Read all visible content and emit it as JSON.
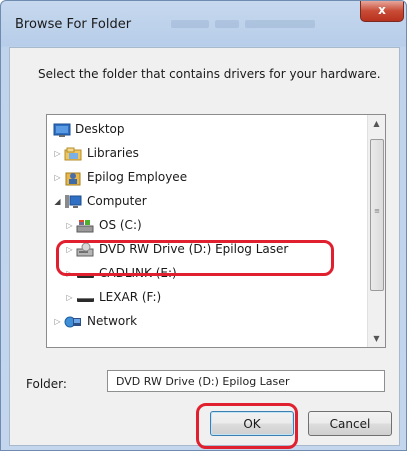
{
  "window": {
    "title": "Browse For Folder",
    "close_label": "x"
  },
  "instruction": "Select the folder that contains drivers for your hardware.",
  "tree": {
    "items": [
      {
        "label": "Desktop",
        "icon": "desktop-icon"
      },
      {
        "label": "Libraries",
        "icon": "libraries-icon"
      },
      {
        "label": "Epilog Employee",
        "icon": "user-folder-icon"
      },
      {
        "label": "Computer",
        "icon": "computer-icon"
      },
      {
        "label": "OS (C:)",
        "icon": "hard-drive-icon"
      },
      {
        "label": "DVD RW Drive (D:) Epilog Laser",
        "icon": "dvd-drive-icon"
      },
      {
        "label": "CADLINK (E:)",
        "icon": "removable-drive-icon"
      },
      {
        "label": "LEXAR (F:)",
        "icon": "removable-drive-icon"
      },
      {
        "label": "Network",
        "icon": "network-icon"
      }
    ]
  },
  "folder": {
    "label": "Folder:",
    "value": "DVD RW Drive (D:) Epilog Laser"
  },
  "buttons": {
    "ok": "OK",
    "cancel": "Cancel"
  },
  "highlight_color": "#e0202e"
}
